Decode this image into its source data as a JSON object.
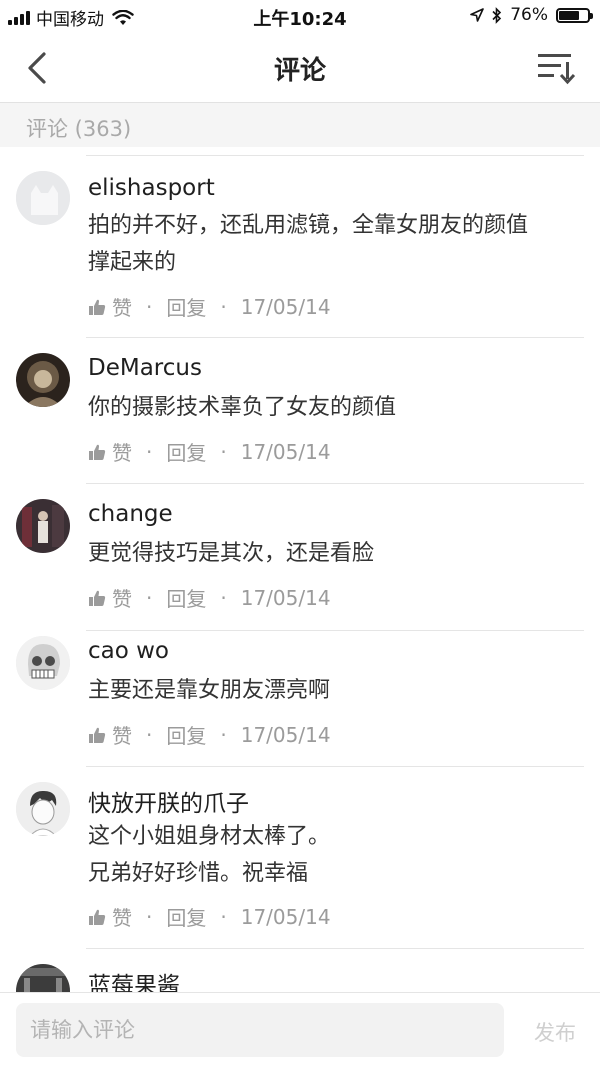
{
  "status_bar": {
    "carrier": "中国移动",
    "time": "上午10:24",
    "battery": "76%",
    "battery_level": 0.76
  },
  "nav": {
    "title": "评论"
  },
  "section": {
    "title": "评论 (363)"
  },
  "comments": [
    {
      "user": "elishasport",
      "lines": [
        "拍的并不好，还乱用滤镜，全靠女朋友的颜值",
        "撑起来的"
      ],
      "like_label": "赞",
      "reply_label": "回复",
      "date": "17/05/14",
      "avatar_icon": "default-avatar-icon"
    },
    {
      "user": "DeMarcus",
      "lines": [
        "你的摄影技术辜负了女友的颜值"
      ],
      "like_label": "赞",
      "reply_label": "回复",
      "date": "17/05/14",
      "avatar_icon": "portrait-avatar-icon"
    },
    {
      "user": "change",
      "lines": [
        "更觉得技巧是其次，还是看脸"
      ],
      "like_label": "赞",
      "reply_label": "回复",
      "date": "17/05/14",
      "avatar_icon": "photo-avatar-icon"
    },
    {
      "user": "cao wo",
      "lines": [
        "主要还是靠女朋友漂亮啊"
      ],
      "like_label": "赞",
      "reply_label": "回复",
      "date": "17/05/14",
      "avatar_icon": "skull-avatar-icon"
    },
    {
      "user": "快放开朕的爪子",
      "lines": [
        "这个小姐姐身材太棒了。",
        "兄弟好好珍惜。祝幸福"
      ],
      "like_label": "赞",
      "reply_label": "回复",
      "date": "17/05/14",
      "avatar_icon": "cartoon-avatar-icon"
    },
    {
      "user": "蓝莓果酱",
      "lines": [],
      "like_label": "",
      "reply_label": "",
      "date": "",
      "avatar_icon": "photo-avatar-icon"
    }
  ],
  "input": {
    "placeholder": "请输入评论",
    "value": "",
    "publish_label": "发布"
  },
  "colors": {
    "meta_text": "#9b9b9b",
    "section_bg": "#f5f5f5",
    "publish_disabled": "#cfcfcf"
  }
}
